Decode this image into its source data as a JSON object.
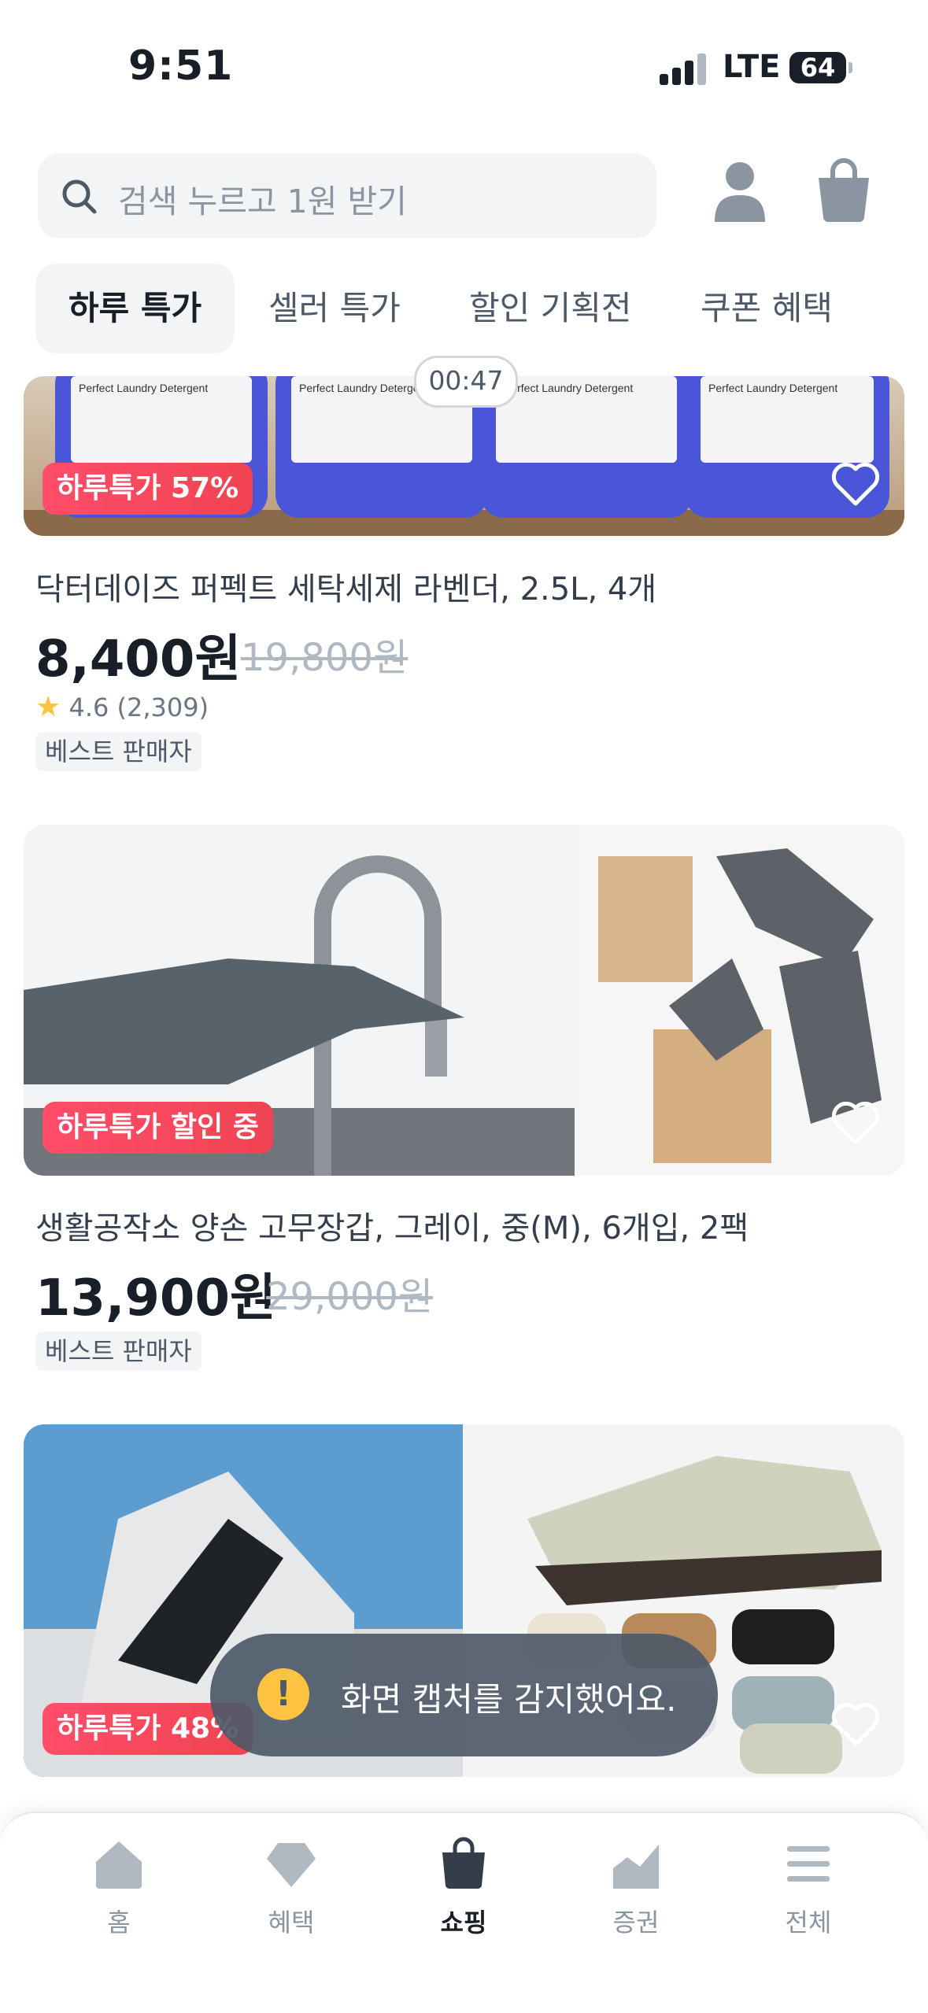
{
  "status_bar": {
    "time": "9:51",
    "network": "LTE",
    "battery": "64"
  },
  "search": {
    "placeholder": "검색 누르고 1원 받기"
  },
  "tabs": [
    {
      "label": "하루 특가",
      "active": true
    },
    {
      "label": "셀러 특가",
      "active": false
    },
    {
      "label": "할인 기획전",
      "active": false
    },
    {
      "label": "쿠폰 혜택",
      "active": false
    }
  ],
  "timer": "00:47",
  "products": [
    {
      "badge": "하루특가 57%",
      "name": "닥터데이즈 퍼펙트 세탁세제 라벤더, 2.5L, 4개",
      "price": "8,400원",
      "original_price": "19,800원",
      "rating": "4.6",
      "reviews": "(2,309)",
      "tag": "베스트 판매자",
      "label_text": "Perfect Laundry Detergent"
    },
    {
      "badge": "하루특가 할인 중",
      "name": "생활공작소 양손 고무장갑, 그레이, 중(M), 6개입, 2팩",
      "price": "13,900원",
      "original_price": "29,000원",
      "tag": "베스트 판매자"
    },
    {
      "badge": "하루특가 48%"
    }
  ],
  "toast": {
    "message": "화면 캡처를 감지했어요."
  },
  "bottom_nav": [
    {
      "label": "홈",
      "icon": "home-icon"
    },
    {
      "label": "혜택",
      "icon": "diamond-icon"
    },
    {
      "label": "쇼핑",
      "icon": "shopping-bag-icon",
      "active": true
    },
    {
      "label": "증권",
      "icon": "chart-icon"
    },
    {
      "label": "전체",
      "icon": "menu-icon"
    }
  ],
  "colors": {
    "accent_red": "#f04452",
    "text_primary": "#191f28",
    "text_secondary": "#8b95a1",
    "surface": "#f2f4f6"
  }
}
